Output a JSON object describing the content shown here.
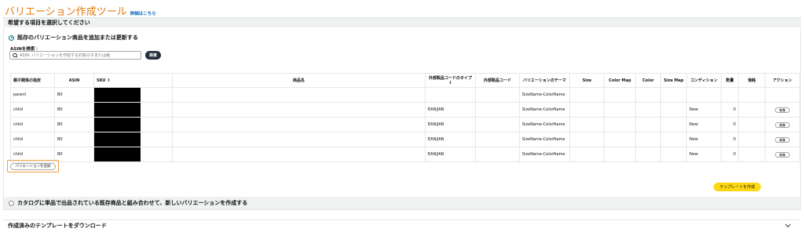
{
  "header": {
    "title": "バリエーション作成ツール",
    "details_link": "詳細はこちら"
  },
  "section": {
    "heading": "希望する項目を選択してください"
  },
  "option_existing": {
    "label": "既存のバリエーション商品を追加または更新する",
    "selected": true
  },
  "asin_search": {
    "label": "ASINを検索",
    "info_icon": "i",
    "placeholder": "ASIN: バリエーションを作成する対象の子または親",
    "button_label": "検索"
  },
  "table": {
    "headers": [
      "親子関係の指定",
      "ASIN",
      "SKU",
      "商品名",
      "外部製品コードのタイプ",
      "外部製品コード",
      "バリエーションのテーマ",
      "Size",
      "Color Map",
      "Color",
      "Size Map",
      "コンディション",
      "数量",
      "価格",
      "アクション"
    ],
    "sku_sort_icon": "↕",
    "ext_type_sort_icon": "↕",
    "rows": [
      {
        "relation": "parent",
        "asin": "B0",
        "sku": "",
        "name": "",
        "ext_type": "",
        "ext_code": "",
        "theme": "SizeName-ColorName",
        "size": "",
        "color_map": "",
        "color": "",
        "size_map": "",
        "condition": "",
        "qty": "",
        "price": "",
        "action": ""
      },
      {
        "relation": "child",
        "asin": "B0",
        "sku": "",
        "name": "",
        "ext_type": "EAN/JAN",
        "ext_code": "",
        "theme": "SizeName-ColorName",
        "size": "",
        "color_map": "",
        "color": "",
        "size_map": "",
        "condition": "New",
        "qty": "0",
        "price": "",
        "action": "編集"
      },
      {
        "relation": "child",
        "asin": "B0",
        "sku": "",
        "name": "",
        "ext_type": "EAN/JAN",
        "ext_code": "",
        "theme": "SizeName-ColorName",
        "size": "",
        "color_map": "",
        "color": "",
        "size_map": "",
        "condition": "New",
        "qty": "0",
        "price": "",
        "action": "編集"
      },
      {
        "relation": "child",
        "asin": "B0",
        "sku": "",
        "name": "",
        "ext_type": "EAN/JAN",
        "ext_code": "",
        "theme": "SizeName-ColorName",
        "size": "",
        "color_map": "",
        "color": "",
        "size_map": "",
        "condition": "New",
        "qty": "0",
        "price": "",
        "action": "編集"
      },
      {
        "relation": "child",
        "asin": "B0",
        "sku": "",
        "name": "",
        "ext_type": "EAN/JAN",
        "ext_code": "",
        "theme": "SizeName-ColorName",
        "size": "",
        "color_map": "",
        "color": "",
        "size_map": "",
        "condition": "New",
        "qty": "0",
        "price": "",
        "action": "編集"
      }
    ]
  },
  "create_variation_button": "バリエーションを追加",
  "create_template_button": "テンプレートを作成",
  "option_catalog": {
    "label": "カタログに単品で出品されている既存商品と組み合わせて、新しいバリエーションを作成する",
    "selected": false
  },
  "download_section": {
    "label": "作成済みのテンプレートをダウンロード"
  },
  "colors": {
    "title": "#e47911",
    "link": "#0066c0",
    "primary_button": "#ffd814",
    "highlight_border": "#f0a040",
    "dark_button": "#232f3e"
  }
}
